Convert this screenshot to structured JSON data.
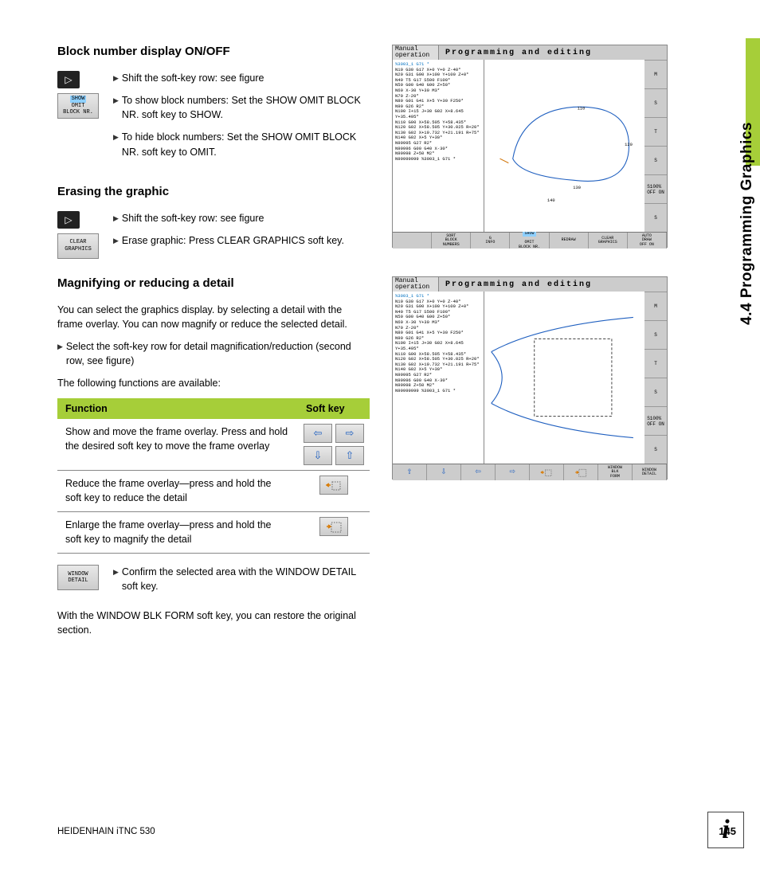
{
  "sideTab": "4.4 Programming Graphics",
  "sections": {
    "blockNumber": {
      "title": "Block number display ON/OFF",
      "shift": "Shift the soft-key row: see figure",
      "show": "To show block numbers: Set the SHOW OMIT BLOCK NR. soft key to SHOW.",
      "hide": "To hide block numbers: Set the SHOW OMIT BLOCK NR. soft key to OMIT.",
      "softkey": {
        "line1": "SHOW",
        "line2": "OMIT",
        "line3": "BLOCK NR."
      }
    },
    "erasing": {
      "title": "Erasing the graphic",
      "shift": "Shift the soft-key row: see figure",
      "erase": "Erase graphic: Press CLEAR GRAPHICS soft key.",
      "softkey": {
        "line1": "CLEAR",
        "line2": "GRAPHICS"
      }
    },
    "magnify": {
      "title": "Magnifying or reducing a detail",
      "intro": "You can select the graphics display. by selecting a detail with the frame overlay. You can now magnify or reduce the selected detail.",
      "select": "Select the soft-key row for detail magnification/reduction (second row, see figure)",
      "available": "The following functions are available:",
      "table": {
        "headFunc": "Function",
        "headKey": "Soft key",
        "row1": "Show and move the frame overlay. Press and hold the desired soft key to move the frame overlay",
        "row2": "Reduce the frame overlay—press and hold the soft key to reduce the detail",
        "row3": "Enlarge the frame overlay—press and hold the soft key to magnify the detail"
      },
      "confirm": "Confirm the selected area with the WINDOW DETAIL soft key.",
      "confirmKey": {
        "line1": "WINDOW",
        "line2": "DETAIL"
      },
      "restore": "With the WINDOW BLK FORM soft key, you can restore the original section."
    }
  },
  "screenshots": {
    "mode": "Manual\noperation",
    "title": "Programming and editing",
    "code": [
      "%3003_1 G71 *",
      "N10 G30 G17 X+0 Y+0 Z-40*",
      "N20 G31 G90 X+100 Y+100 Z+0*",
      "N40 T5 G17 S500 F100*",
      "N50 G00 G40 G90 Z+50*",
      "N60 X-30 Y+30 M3*",
      "N70 Z-20*",
      "N80 G01 G41 X+5 Y+30 F250*",
      "N90 G26 R2*",
      "N100 I+15 J+30 G02 X+8.645 Y+35.495*",
      "N110 G00 X+58.505 Y+58.435*",
      "N120 G02 X+58.505 Y+30.025 R+20*",
      "N130 G02 X+19.732 Y+21.191 R+75*",
      "N140 G02 X+5 Y+30*",
      "N99995 G27 R2*",
      "N99996 G00 G40 X-30*",
      "N99998 Z+50 M2*",
      "N99999999 %3003_1 G71 *"
    ],
    "side": [
      "M",
      "S",
      "T",
      "S",
      "S100%\nOFF ON",
      "S"
    ],
    "softkeys1": [
      "",
      "SORT\nBLOCK\nNUMBERS",
      "G\nINFO",
      "SHOW\nOMIT\nBLOCK NR.",
      "REDRAW",
      "CLEAR\nGRAPHICS",
      "AUTO\nDRAW\nOFF ON"
    ],
    "softkeys2_labels": {
      "blkform": "WINDOW\nBLK\nFORM",
      "detail": "WINDOW\nDETAIL"
    }
  },
  "footer": {
    "left": "HEIDENHAIN iTNC 530",
    "page": "145"
  }
}
